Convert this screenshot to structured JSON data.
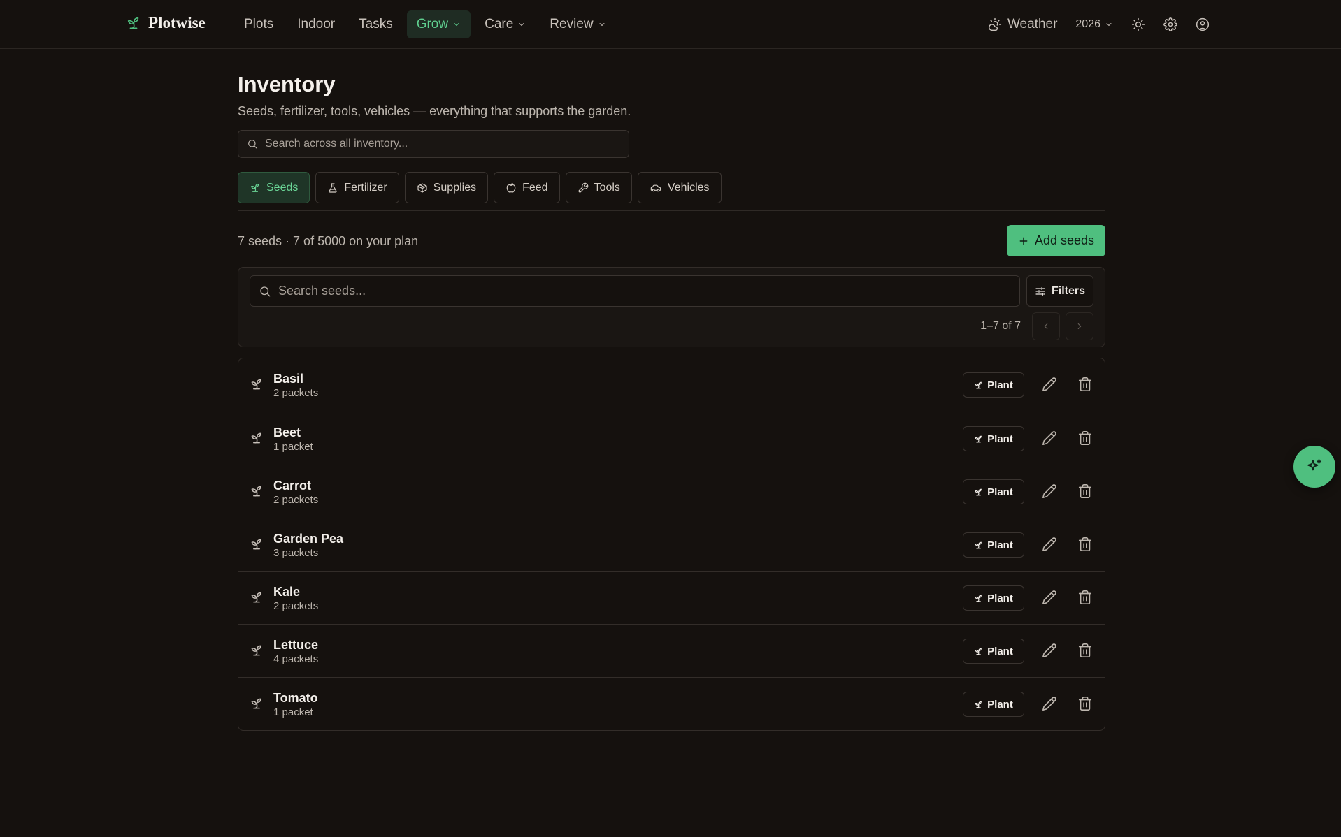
{
  "brand": {
    "name": "Plotwise"
  },
  "nav": {
    "items": [
      {
        "label": "Plots"
      },
      {
        "label": "Indoor"
      },
      {
        "label": "Tasks"
      },
      {
        "label": "Grow"
      },
      {
        "label": "Care"
      },
      {
        "label": "Review"
      }
    ],
    "active": "Grow",
    "weather_label": "Weather",
    "year": "2026"
  },
  "page": {
    "title": "Inventory",
    "subtitle": "Seeds, fertilizer, tools, vehicles — everything that supports the garden.",
    "global_search_placeholder": "Search across all inventory..."
  },
  "tabs": [
    {
      "label": "Seeds",
      "icon": "sprout-icon",
      "active": true
    },
    {
      "label": "Fertilizer",
      "icon": "flask-icon",
      "active": false
    },
    {
      "label": "Supplies",
      "icon": "box-icon",
      "active": false
    },
    {
      "label": "Feed",
      "icon": "apple-icon",
      "active": false
    },
    {
      "label": "Tools",
      "icon": "wrench-icon",
      "active": false
    },
    {
      "label": "Vehicles",
      "icon": "car-icon",
      "active": false
    }
  ],
  "summary": {
    "count_text": "7 seeds · 7 of 5000 on your plan",
    "add_label": "Add seeds"
  },
  "filters": {
    "search_placeholder": "Search seeds...",
    "filters_label": "Filters",
    "pagination_text": "1–7 of 7"
  },
  "seeds": [
    {
      "name": "Basil",
      "quantity": "2 packets"
    },
    {
      "name": "Beet",
      "quantity": "1 packet"
    },
    {
      "name": "Carrot",
      "quantity": "2 packets"
    },
    {
      "name": "Garden Pea",
      "quantity": "3 packets"
    },
    {
      "name": "Kale",
      "quantity": "2 packets"
    },
    {
      "name": "Lettuce",
      "quantity": "4 packets"
    },
    {
      "name": "Tomato",
      "quantity": "1 packet"
    }
  ],
  "row_actions": {
    "plant_label": "Plant"
  },
  "colors": {
    "background": "#15110e",
    "accent": "#4fbf7f",
    "active_tab_bg": "#1f3527",
    "border": "#332d29"
  }
}
